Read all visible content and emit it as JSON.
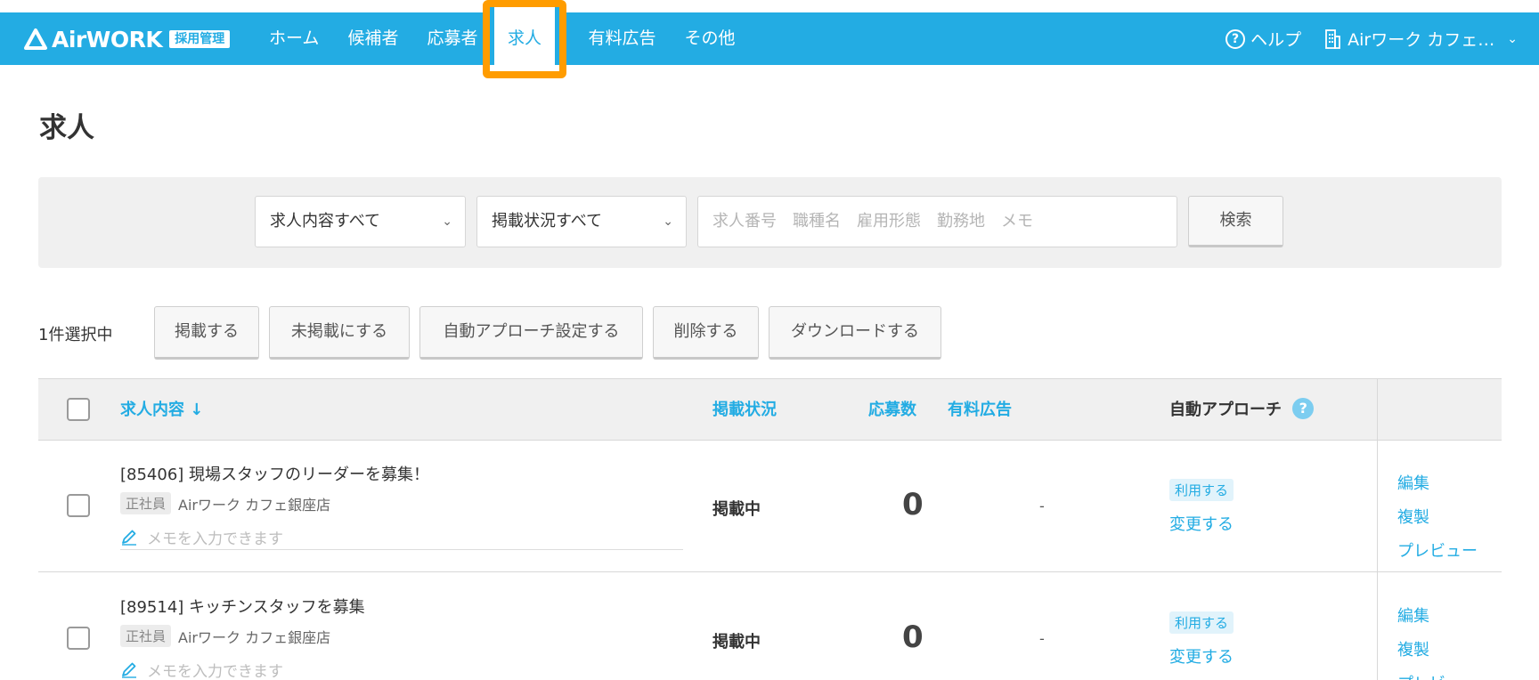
{
  "header": {
    "logo_text": "AirWORK",
    "logo_badge": "採用管理",
    "nav": [
      {
        "label": "ホーム"
      },
      {
        "label": "候補者"
      },
      {
        "label": "応募者"
      },
      {
        "label": "求人"
      },
      {
        "label": "有料広告"
      },
      {
        "label": "その他"
      }
    ],
    "active_nav": "求人",
    "help_label": "ヘルプ",
    "store_label": "Airワーク カフェ…",
    "brand_color": "#23ace3",
    "highlight_color": "#ff9c00"
  },
  "page": {
    "title": "求人"
  },
  "search": {
    "content_select": "求人内容すべて",
    "status_select": "掲載状況すべて",
    "placeholder": "求人番号　職種名　雇用形態　勤務地　メモ",
    "button_label": "検索"
  },
  "actions": {
    "selected_count": "1件選択中",
    "buttons": [
      "掲載する",
      "未掲載にする",
      "自動アプローチ設定する",
      "削除する",
      "ダウンロードする"
    ]
  },
  "table": {
    "headers": {
      "content": "求人内容",
      "sort_icon": "arrow-down-icon",
      "status": "掲載状況",
      "applicants": "応募数",
      "paid_ads": "有料広告",
      "auto_approach": "自動アプローチ"
    },
    "rows": [
      {
        "title": "[85406] 現場スタッフのリーダーを募集！",
        "employment_type": "正社員",
        "store": "Airワーク カフェ銀座店",
        "memo_placeholder": "メモを入力できます",
        "status": "掲載中",
        "applicants": "0",
        "paid_ads": "-",
        "auto_badge": "利用する",
        "auto_change": "変更する",
        "links": [
          "編集",
          "複製",
          "プレビュー"
        ]
      },
      {
        "title": "[89514] キッチンスタッフを募集",
        "employment_type": "正社員",
        "store": "Airワーク カフェ銀座店",
        "memo_placeholder": "メモを入力できます",
        "status": "掲載中",
        "applicants": "0",
        "paid_ads": "-",
        "auto_badge": "利用する",
        "auto_change": "変更する",
        "links": [
          "編集",
          "複製",
          "プレビュー"
        ]
      }
    ]
  }
}
